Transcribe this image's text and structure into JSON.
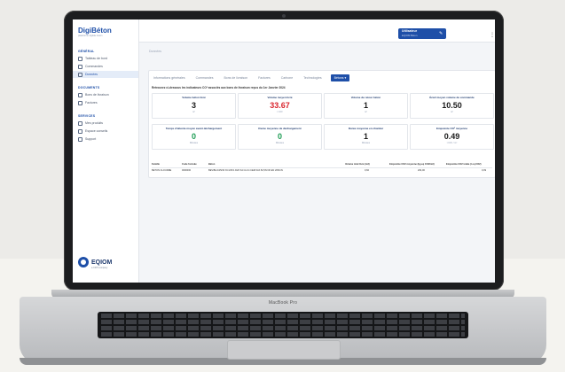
{
  "app": {
    "logo": "DigiBéton",
    "logo_tagline": "plateforme digitale béton"
  },
  "sidebar": {
    "sections": [
      {
        "heading": "GÉNÉRAL",
        "items": [
          "Tableau de bord",
          "Commandes",
          "Données"
        ]
      },
      {
        "heading": "DOCUMENTS",
        "items": [
          "Bons de livraison",
          "Factures"
        ]
      },
      {
        "heading": "SERVICES",
        "items": [
          "Mes produits",
          "Espace conseils",
          "Support"
        ]
      }
    ],
    "footer_brand": "EQIOM",
    "footer_sub": "a CRH company"
  },
  "user": {
    "name": "Utilisateur",
    "role": "EQIOM Béton"
  },
  "breadcrumb": "Données",
  "tabs": [
    "Informations générales",
    "Commandes",
    "Bons de livraison",
    "Factures",
    "Carbone",
    "Technologies",
    "Bétons ▾"
  ],
  "active_tab": 6,
  "description": "Retrouvez ci-dessous les indicateurs CO² associés aux bons de livraison reçus du 1er Janvier 2024",
  "kpis": [
    {
      "title": "Volume béton livré",
      "value": "3",
      "unit": "m³",
      "color": "#1a1a1a"
    },
    {
      "title": "Volume moyen livré",
      "value": "33.67",
      "unit": "t CO²",
      "color": "#d9262e"
    },
    {
      "title": "Volume de retour béton",
      "value": "1",
      "unit": "m³",
      "color": "#1a1a1a"
    },
    {
      "title": "Écart moyen volume de commande",
      "value": "10.50",
      "unit": "m³",
      "color": "#1a1a1a"
    },
    {
      "title": "Temps d'attente moyen avant déchargement",
      "value": "0",
      "unit": "Minutes",
      "color": "#1f9d55"
    },
    {
      "title": "Durée moyenne de déchargement",
      "value": "0",
      "unit": "Minutes",
      "color": "#1f9d55"
    },
    {
      "title": "Durée moyenne en chantier",
      "value": "1",
      "unit": "Minutes",
      "color": "#1a1a1a"
    },
    {
      "title": "Empreinte CO² moyenne",
      "value": "0.49",
      "unit": "t CO² / m³",
      "color": "#1a1a1a"
    }
  ],
  "table": {
    "headers": [
      "Famille",
      "Code formule",
      "Béton",
      "Volume total livré (m3)",
      "Empreinte CO2 moyenne (kg eq CO2/m3)",
      "Empreinte CO2 totale (t eq CO2)"
    ],
    "rows": [
      [
        "BETON CLOURRE",
        "0000000",
        "BEV/BL/C25/30 XC1/XF1 D20 S4 CL0.4 CEM III/A 52,5N NF EN 206/CN",
        "0,60",
        "264,00",
        "0,09"
      ]
    ]
  },
  "device_label": "MacBook Pro"
}
